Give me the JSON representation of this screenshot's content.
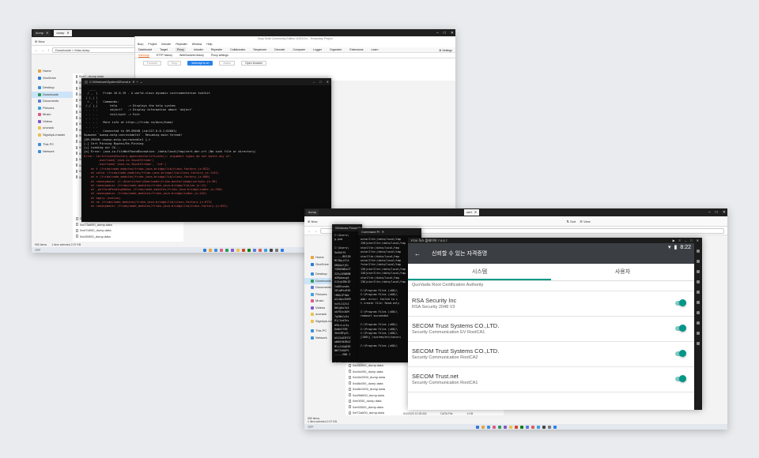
{
  "shot1": {
    "tabs": [
      "dump",
      "dump"
    ],
    "burp": {
      "title": "Burp Suite Community Edition v2023.9.x - Temporary Project",
      "menu": [
        "Burp",
        "Project",
        "Intruder",
        "Repeater",
        "Window",
        "Help"
      ],
      "tabs": [
        "Dashboard",
        "Target",
        "Proxy",
        "Intruder",
        "Repeater",
        "Collaborator",
        "Sequencer",
        "Decoder",
        "Comparer",
        "Logger",
        "Organizer",
        "Extensions",
        "Learn"
      ],
      "settings": "Settings",
      "subtabs": [
        "Intercept",
        "HTTP history",
        "WebSockets history",
        "Proxy settings"
      ],
      "buttons": [
        "Forward",
        "Drop",
        "Intercept is on",
        "Action",
        "Open browser"
      ]
    },
    "explorer": {
      "new": "New",
      "address": "Downloads  >  frida-dump",
      "search": "Search dump",
      "nav": [
        {
          "label": "Home",
          "color": "#e8a33c"
        },
        {
          "label": "OneDrive",
          "color": "#2b79d3"
        },
        {
          "label": "Desktop",
          "color": "#3a8fd9"
        },
        {
          "label": "Downloads",
          "color": "#2b9a5a"
        },
        {
          "label": "Documents",
          "color": "#5a7bd8"
        },
        {
          "label": "Pictures",
          "color": "#39a0e0"
        },
        {
          "label": "Music",
          "color": "#e05a82"
        },
        {
          "label": "Videos",
          "color": "#8257c9"
        },
        {
          "label": "uncrack",
          "color": "#e8c34c"
        },
        {
          "label": "SignApk-master",
          "color": "#e8c34c"
        },
        {
          "label": "This PC",
          "color": "#3a8fd9"
        },
        {
          "label": "Network",
          "color": "#3a8fd9"
        }
      ],
      "files": [
        "0xa7...dump.data",
        "0xa8...dump.data",
        "0xc1...dump.data",
        "0xcf...dump.data",
        "0xd0...dump.data",
        "0xd3...dump.data",
        "0xe2...dump.data",
        "0xe5...dump.data",
        "0xe9...dump.data",
        "0xf1...dump.data",
        "0xf3...dump.data",
        "0xf7...dump.data",
        "0xf8...dump.data",
        "0xfa...dump.data",
        "0xfb...dump.data",
        "0xfc...dump.data",
        "0xfd...dump.data",
        "0xfe...dump.data",
        "0xc72a000_dump.data",
        "0xc73a000_dump.data",
        "0xcf7d000_dump.data",
        "0xd30000_dump.data"
      ],
      "status": [
        "950 items",
        "1 item selected  2.97 KB"
      ]
    },
    "terminal": {
      "title": "C:\\Windows\\System32\\cmd.e",
      "lines": [
        {
          "t": "   ____",
          "c": "dim"
        },
        {
          "t": "  / _  |   Frida 16.0.19 - A world-class dynamic instrumentation toolkit",
          "c": ""
        },
        {
          "t": " | (_| |",
          "c": "dim"
        },
        {
          "t": "  > _  |   Commands:",
          "c": ""
        },
        {
          "t": " /_/ |_|       help      -> Displays the help system",
          "c": ""
        },
        {
          "t": " . . . .       object?   -> Display information about 'object'",
          "c": ""
        },
        {
          "t": " . . . .       exit/quit -> Exit",
          "c": ""
        },
        {
          "t": " . . . .",
          "c": "dim"
        },
        {
          "t": " . . . .   More info at https://frida.re/docs/home/",
          "c": ""
        },
        {
          "t": " . . . .",
          "c": "dim"
        },
        {
          "t": " . . . .   Connected to SM-G965N (id=127.0.0.1:62001)",
          "c": ""
        },
        {
          "t": "Spawned `owasp.mstg.uncrackable1`. Resuming main thread!",
          "c": ""
        },
        {
          "t": "[SM-G965N::owasp.mstg.uncrackable1 ]->",
          "c": ""
        },
        {
          "t": "[.] Cert Pinning Bypass/Re-Pinning",
          "c": ""
        },
        {
          "t": "[+] Loading our CA...",
          "c": ""
        },
        {
          "t": "[o] Error: java.io.FileNotFoundException: /data/local/tmp/cert-der.crt (No such file or directory)",
          "c": ""
        },
        {
          "t": "Error: CertificateFactory.generateCertificate(): argument types do not match any of:",
          "c": "err"
        },
        {
          "t": "        .overload('java.io.InputStream')",
          "c": "err"
        },
        {
          "t": "        .overload('java.io.InputStream', 'int')",
          "c": "err"
        },
        {
          "t": "    at t (frida/node_modules/frida-java-bridge/lib/class-factory.js:622)",
          "c": "err"
        },
        {
          "t": "    at value (frida/node_modules/frida-java-bridge/lib/class-factory.js:1141)",
          "c": "err"
        },
        {
          "t": "    at e (frida/node_modules/frida-java-bridge/lib/class-factory.js:606)",
          "c": "err"
        },
        {
          "t": "    at <anonymous> (C:\\Users\\User\\Downloads\\frida-master\\dump\\certpin.js:36)",
          "c": "err"
        },
        {
          "t": "    at <anonymous> (frida/node_modules/frida-java-bridge/lib/vm.js:12)",
          "c": "err"
        },
        {
          "t": "    at _performPendingVmOps (frida/node_modules/frida-java-bridge/index.js:250)",
          "c": "err"
        },
        {
          "t": "    at <anonymous> (frida/node_modules/frida-java-bridge/index.js:242)",
          "c": "err"
        },
        {
          "t": "    at apply (native)",
          "c": "err"
        },
        {
          "t": "    at ne (frida/node_modules/frida-java-bridge/lib/class-factory.js:673)",
          "c": "err"
        },
        {
          "t": "    at <anonymous> (frida/node_modules/frida-java-bridge/lib/class-factory.js:651)",
          "c": "err"
        }
      ]
    },
    "taskbar": "72°F"
  },
  "shot2": {
    "tabs": [
      "dump",
      "cert"
    ],
    "explorer": {
      "new": "New",
      "sort": "Sort",
      "view": "View",
      "nav": [
        {
          "label": "Home",
          "color": "#e8a33c"
        },
        {
          "label": "OneDrive",
          "color": "#2b79d3"
        },
        {
          "label": "Desktop",
          "color": "#3a8fd9"
        },
        {
          "label": "Downloads",
          "color": "#2b9a5a"
        },
        {
          "label": "Documents",
          "color": "#5a7bd8"
        },
        {
          "label": "Pictures",
          "color": "#39a0e0"
        },
        {
          "label": "Music",
          "color": "#e05a82"
        },
        {
          "label": "Videos",
          "color": "#8257c9"
        },
        {
          "label": "uncrack",
          "color": "#e8c34c"
        },
        {
          "label": "SignApk-master",
          "color": "#e8c34c"
        },
        {
          "label": "This PC",
          "color": "#3a8fd9"
        },
        {
          "label": "Network",
          "color": "#3a8fd9"
        }
      ],
      "files": [
        "0xd30000_dump.data",
        "0xd4c000_dump.data",
        "0xd4e2000_dump.data",
        "0xd8c000_dump.data",
        "0xd8e1000_dump.data",
        "0xd9fd000_dump.data",
        "0xe0000_dump.data",
        "0xe53000_dump.data",
        "0xf72a000_dump.data",
        "0xf73a000_dump.data",
        "0xf7d000_dump.data"
      ],
      "meta": [
        "6/4/2023 12:28 AM",
        "DATA File",
        "4 KB"
      ],
      "status": [
        "950 items",
        "1 item selected  2.97 KB"
      ]
    },
    "term_a": {
      "title": "Windows PowerShell",
      "lines": [
        "C:\\Users\\",
        "g.pem",
        "",
        "C:\\Users\\",
        "9a5b5f5",
        "-----BEGIN",
        "MIIDpjCCA",
        "UBQAwYjEL",
        "YXR0ZWQxGT",
        "Z2VyIENBMB",
        "dXRpbmcgQ",
        "X1Vyb3BhIE",
        "Ca8Ktwvdm",
        "2DlwMtzR2K",
        "lMDU1PfWd",
        "b2c0pvZhRM",
        "h4fLCSZtZ",
        "D6CgKo7a3",
        "okFR2n4bM",
        "7gXNkCu5s",
        "R1/1sdIhs",
        "09U+t+L5y",
        "KeWn5f5M",
        "3hkCBFgfL",
        "b5J2uD3FEZ",
        "oWHOtNJBkZ",
        "MlxJiUqDSR",
        "NWT7nKbPV",
        "-----END C",
        "",
        "C:\\Users\\"
      ]
    },
    "term_b": {
      "title": "Command Pr",
      "lines": [
        "ostar2lte:/data/local/tmp",
        "130|star2lte:/data/local/tmp",
        "star2lte:/data/local/tmp",
        "ostar2lte:/data/local/tmp",
        "star2lte:/data/local/tmp",
        "ostar2lte:/data/local/tmp",
        "*star2lte:/data/local/tmp",
        "130|star2lte:/data/local/tmp",
        "130|star2lte:/data/local/tmp",
        "star2lte:/data/local/tmp",
        "130|star2lte:/data/local/tmp",
        "",
        "C:\\Program Files (x86)\\",
        "C:\\Program Files (x86)\\",
        "adb: error: failed to c",
        "t create file: Read-only",
        "",
        "C:\\Program Files (x86)\\",
        "remount succeeded",
        "",
        "C:\\Program Files (x86)\\",
        "C:\\Program Files (x86)\\",
        "C:\\Program Files (x86)\\",
        "[100%] /system/etc/securi",
        "",
        "C:\\Program Files (x86)\\"
      ]
    },
    "emulator": {
      "title": "FOX  녹스 플레이어 7.0.5.7",
      "phone": {
        "time": "8:22",
        "header": "신뢰할 수 있는 자격증명",
        "tab_system": "시스템",
        "tab_user": "사용자",
        "partial_item": "QuoVadis Root Certification Authority",
        "certs": [
          {
            "title": "RSA Security Inc",
            "sub": "RSA Security 2048 V3"
          },
          {
            "title": "SECOM Trust Systems CO.,LTD.",
            "sub": "Security Communication EV RootCA1"
          },
          {
            "title": "SECOM Trust Systems CO.,LTD.",
            "sub": "Security Communication RootCA2"
          },
          {
            "title": "SECOM Trust.net",
            "sub": "Security Communication RootCA1"
          }
        ]
      }
    },
    "taskbar": "72°F"
  },
  "colors": {
    "accent_teal": "#009688",
    "error_red": "#e05a5a",
    "burp_orange": "#e8661d",
    "intercept_blue": "#2680eb"
  }
}
